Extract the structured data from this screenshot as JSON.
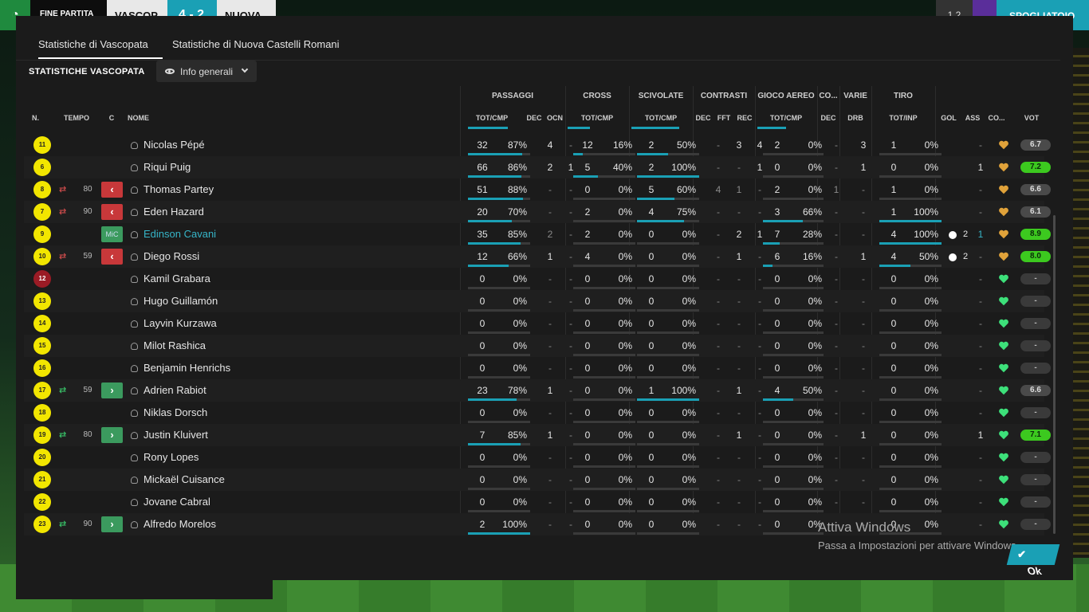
{
  "topbar": {
    "status": "FINE PARTITA",
    "home": "VASCOP",
    "score": "4 - 2",
    "away": "NUOVA",
    "counter": "1 2",
    "menu": "⌄",
    "next": "SPOGLIATOIO"
  },
  "tabs": [
    "Statistiche di Vascopata",
    "Statistiche di Nuova Castelli Romani"
  ],
  "section_title": "STATISTICHE VASCOPATA",
  "view_dropdown": "Info generali",
  "group_headers": {
    "passaggi": "PASSAGGI",
    "cross": "CROSS",
    "scivolate": "SCIVOLATE",
    "contrasti": "CONTRASTI",
    "gioco_aereo": "GIOCO AEREO",
    "co": "CO...",
    "varie": "VARIE",
    "tiro": "TIRO"
  },
  "col_headers": {
    "n": "N.",
    "tempo": "TEMPO",
    "c": "C",
    "nome": "NOME",
    "pass": "TOT/CMP",
    "pass_dec": "DEC",
    "pass_ocn": "OCN",
    "cross": "TOT/CMP",
    "sciv": "TOT/CMP",
    "con_dec": "DEC",
    "con_fft": "FFT",
    "con_rec": "REC",
    "aereo": "TOT/CMP",
    "co_dec": "DEC",
    "drb": "DRB",
    "tiro": "TOT/INP",
    "gol": "GOL",
    "ass": "ASS",
    "co2": "CO...",
    "vot": "VOT"
  },
  "players": [
    {
      "n": "11",
      "sub": "",
      "min": "",
      "pos": "",
      "name": "Nicolas Pépé",
      "hl": false,
      "pt": "32",
      "pp": "87%",
      "pf": 0.87,
      "pdec": "4",
      "pocn": "-",
      "ct": "12",
      "cp": "16%",
      "cf": 0.16,
      "st": "2",
      "sp": "50%",
      "sf": 0.5,
      "kdec": "-",
      "kfft": "3",
      "krec": "4",
      "at": "2",
      "ap": "0%",
      "af": 0,
      "codec": "-",
      "drb": "3",
      "tt": "1",
      "tp": "0%",
      "tf": 0,
      "gol": "",
      "ass": "-",
      "vot": "6.7",
      "vc": "grey"
    },
    {
      "n": "6",
      "sub": "",
      "min": "",
      "pos": "",
      "name": "Riqui Puig",
      "hl": false,
      "pt": "66",
      "pp": "86%",
      "pf": 0.86,
      "pdec": "2",
      "pocn": "1",
      "ct": "5",
      "cp": "40%",
      "cf": 0.4,
      "st": "2",
      "sp": "100%",
      "sf": 1,
      "kdec": "-",
      "kfft": "-",
      "krec": "1",
      "at": "0",
      "ap": "0%",
      "af": 0,
      "codec": "-",
      "drb": "1",
      "tt": "0",
      "tp": "0%",
      "tf": 0,
      "gol": "",
      "ass": "1",
      "vot": "7.2",
      "vc": "green"
    },
    {
      "n": "8",
      "sub": "out",
      "min": "80",
      "pos": "out",
      "name": "Thomas Partey",
      "hl": false,
      "pt": "51",
      "pp": "88%",
      "pf": 0.88,
      "pdec": "-",
      "pocn": "-",
      "ct": "0",
      "cp": "0%",
      "cf": 0,
      "st": "5",
      "sp": "60%",
      "sf": 0.6,
      "kdec": "4",
      "kfft": "1",
      "krec": "-",
      "at": "2",
      "ap": "0%",
      "af": 0,
      "codec": "1",
      "drb": "-",
      "tt": "1",
      "tp": "0%",
      "tf": 0,
      "gol": "",
      "ass": "-",
      "vot": "6.6",
      "vc": "grey"
    },
    {
      "n": "7",
      "sub": "out",
      "min": "90",
      "pos": "out",
      "name": "Eden Hazard",
      "hl": false,
      "pt": "20",
      "pp": "70%",
      "pf": 0.7,
      "pdec": "-",
      "pocn": "-",
      "ct": "2",
      "cp": "0%",
      "cf": 0,
      "st": "4",
      "sp": "75%",
      "sf": 0.75,
      "kdec": "-",
      "kfft": "-",
      "krec": "-",
      "at": "3",
      "ap": "66%",
      "af": 0.66,
      "codec": "-",
      "drb": "-",
      "tt": "1",
      "tp": "100%",
      "tf": 1,
      "gol": "",
      "ass": "-",
      "vot": "6.1",
      "vc": "grey"
    },
    {
      "n": "9",
      "sub": "",
      "min": "",
      "pos": "mc",
      "name": "Edinson Cavani",
      "hl": true,
      "pt": "35",
      "pp": "85%",
      "pf": 0.85,
      "pdec": "2",
      "pocn": "-",
      "ct": "2",
      "cp": "0%",
      "cf": 0,
      "st": "0",
      "sp": "0%",
      "sf": 0,
      "kdec": "-",
      "kfft": "2",
      "krec": "1",
      "at": "7",
      "ap": "28%",
      "af": 0.28,
      "codec": "-",
      "drb": "-",
      "tt": "4",
      "tp": "100%",
      "tf": 1,
      "gol": "2",
      "ass": "1",
      "vot": "8.9",
      "vc": "green"
    },
    {
      "n": "10",
      "sub": "out",
      "min": "59",
      "pos": "out",
      "name": "Diego Rossi",
      "hl": false,
      "pt": "12",
      "pp": "66%",
      "pf": 0.66,
      "pdec": "1",
      "pocn": "-",
      "ct": "4",
      "cp": "0%",
      "cf": 0,
      "st": "0",
      "sp": "0%",
      "sf": 0,
      "kdec": "-",
      "kfft": "1",
      "krec": "-",
      "at": "6",
      "ap": "16%",
      "af": 0.16,
      "codec": "-",
      "drb": "1",
      "tt": "4",
      "tp": "50%",
      "tf": 0.5,
      "gol": "2",
      "ass": "-",
      "vot": "8.0",
      "vc": "green"
    },
    {
      "n": "12",
      "sub": "",
      "min": "",
      "pos": "",
      "gk": true,
      "name": "Kamil Grabara",
      "hl": false,
      "pt": "0",
      "pp": "0%",
      "pf": 0,
      "pdec": "-",
      "pocn": "-",
      "ct": "0",
      "cp": "0%",
      "cf": 0,
      "st": "0",
      "sp": "0%",
      "sf": 0,
      "kdec": "-",
      "kfft": "-",
      "krec": "-",
      "at": "0",
      "ap": "0%",
      "af": 0,
      "codec": "-",
      "drb": "-",
      "tt": "0",
      "tp": "0%",
      "tf": 0,
      "gol": "",
      "ass": "-",
      "vot": "-",
      "vc": "none"
    },
    {
      "n": "13",
      "sub": "",
      "min": "",
      "pos": "",
      "name": "Hugo Guillamón",
      "hl": false,
      "pt": "0",
      "pp": "0%",
      "pf": 0,
      "pdec": "-",
      "pocn": "-",
      "ct": "0",
      "cp": "0%",
      "cf": 0,
      "st": "0",
      "sp": "0%",
      "sf": 0,
      "kdec": "-",
      "kfft": "-",
      "krec": "-",
      "at": "0",
      "ap": "0%",
      "af": 0,
      "codec": "-",
      "drb": "-",
      "tt": "0",
      "tp": "0%",
      "tf": 0,
      "gol": "",
      "ass": "-",
      "vot": "-",
      "vc": "none"
    },
    {
      "n": "14",
      "sub": "",
      "min": "",
      "pos": "",
      "name": "Layvin Kurzawa",
      "hl": false,
      "pt": "0",
      "pp": "0%",
      "pf": 0,
      "pdec": "-",
      "pocn": "-",
      "ct": "0",
      "cp": "0%",
      "cf": 0,
      "st": "0",
      "sp": "0%",
      "sf": 0,
      "kdec": "-",
      "kfft": "-",
      "krec": "-",
      "at": "0",
      "ap": "0%",
      "af": 0,
      "codec": "-",
      "drb": "-",
      "tt": "0",
      "tp": "0%",
      "tf": 0,
      "gol": "",
      "ass": "-",
      "vot": "-",
      "vc": "none"
    },
    {
      "n": "15",
      "sub": "",
      "min": "",
      "pos": "",
      "name": "Milot Rashica",
      "hl": false,
      "pt": "0",
      "pp": "0%",
      "pf": 0,
      "pdec": "-",
      "pocn": "-",
      "ct": "0",
      "cp": "0%",
      "cf": 0,
      "st": "0",
      "sp": "0%",
      "sf": 0,
      "kdec": "-",
      "kfft": "-",
      "krec": "-",
      "at": "0",
      "ap": "0%",
      "af": 0,
      "codec": "-",
      "drb": "-",
      "tt": "0",
      "tp": "0%",
      "tf": 0,
      "gol": "",
      "ass": "-",
      "vot": "-",
      "vc": "none"
    },
    {
      "n": "16",
      "sub": "",
      "min": "",
      "pos": "",
      "name": "Benjamin Henrichs",
      "hl": false,
      "pt": "0",
      "pp": "0%",
      "pf": 0,
      "pdec": "-",
      "pocn": "-",
      "ct": "0",
      "cp": "0%",
      "cf": 0,
      "st": "0",
      "sp": "0%",
      "sf": 0,
      "kdec": "-",
      "kfft": "-",
      "krec": "-",
      "at": "0",
      "ap": "0%",
      "af": 0,
      "codec": "-",
      "drb": "-",
      "tt": "0",
      "tp": "0%",
      "tf": 0,
      "gol": "",
      "ass": "-",
      "vot": "-",
      "vc": "none"
    },
    {
      "n": "17",
      "sub": "in",
      "min": "59",
      "pos": "in",
      "name": "Adrien Rabiot",
      "hl": false,
      "pt": "23",
      "pp": "78%",
      "pf": 0.78,
      "pdec": "1",
      "pocn": "-",
      "ct": "0",
      "cp": "0%",
      "cf": 0,
      "st": "1",
      "sp": "100%",
      "sf": 1,
      "kdec": "-",
      "kfft": "1",
      "krec": "-",
      "at": "4",
      "ap": "50%",
      "af": 0.5,
      "codec": "-",
      "drb": "-",
      "tt": "0",
      "tp": "0%",
      "tf": 0,
      "gol": "",
      "ass": "-",
      "vot": "6.6",
      "vc": "grey"
    },
    {
      "n": "18",
      "sub": "",
      "min": "",
      "pos": "",
      "name": "Niklas Dorsch",
      "hl": false,
      "pt": "0",
      "pp": "0%",
      "pf": 0,
      "pdec": "-",
      "pocn": "-",
      "ct": "0",
      "cp": "0%",
      "cf": 0,
      "st": "0",
      "sp": "0%",
      "sf": 0,
      "kdec": "-",
      "kfft": "-",
      "krec": "-",
      "at": "0",
      "ap": "0%",
      "af": 0,
      "codec": "-",
      "drb": "-",
      "tt": "0",
      "tp": "0%",
      "tf": 0,
      "gol": "",
      "ass": "-",
      "vot": "-",
      "vc": "none"
    },
    {
      "n": "19",
      "sub": "in",
      "min": "80",
      "pos": "in",
      "name": "Justin Kluivert",
      "hl": false,
      "pt": "7",
      "pp": "85%",
      "pf": 0.85,
      "pdec": "1",
      "pocn": "-",
      "ct": "0",
      "cp": "0%",
      "cf": 0,
      "st": "0",
      "sp": "0%",
      "sf": 0,
      "kdec": "-",
      "kfft": "1",
      "krec": "-",
      "at": "0",
      "ap": "0%",
      "af": 0,
      "codec": "-",
      "drb": "1",
      "tt": "0",
      "tp": "0%",
      "tf": 0,
      "gol": "",
      "ass": "1",
      "vot": "7.1",
      "vc": "green"
    },
    {
      "n": "20",
      "sub": "",
      "min": "",
      "pos": "",
      "name": "Rony Lopes",
      "hl": false,
      "pt": "0",
      "pp": "0%",
      "pf": 0,
      "pdec": "-",
      "pocn": "-",
      "ct": "0",
      "cp": "0%",
      "cf": 0,
      "st": "0",
      "sp": "0%",
      "sf": 0,
      "kdec": "-",
      "kfft": "-",
      "krec": "-",
      "at": "0",
      "ap": "0%",
      "af": 0,
      "codec": "-",
      "drb": "-",
      "tt": "0",
      "tp": "0%",
      "tf": 0,
      "gol": "",
      "ass": "-",
      "vot": "-",
      "vc": "none"
    },
    {
      "n": "21",
      "sub": "",
      "min": "",
      "pos": "",
      "name": "Mickaël Cuisance",
      "hl": false,
      "pt": "0",
      "pp": "0%",
      "pf": 0,
      "pdec": "-",
      "pocn": "-",
      "ct": "0",
      "cp": "0%",
      "cf": 0,
      "st": "0",
      "sp": "0%",
      "sf": 0,
      "kdec": "-",
      "kfft": "-",
      "krec": "-",
      "at": "0",
      "ap": "0%",
      "af": 0,
      "codec": "-",
      "drb": "-",
      "tt": "0",
      "tp": "0%",
      "tf": 0,
      "gol": "",
      "ass": "-",
      "vot": "-",
      "vc": "none"
    },
    {
      "n": "22",
      "sub": "",
      "min": "",
      "pos": "",
      "name": "Jovane Cabral",
      "hl": false,
      "pt": "0",
      "pp": "0%",
      "pf": 0,
      "pdec": "-",
      "pocn": "-",
      "ct": "0",
      "cp": "0%",
      "cf": 0,
      "st": "0",
      "sp": "0%",
      "sf": 0,
      "kdec": "-",
      "kfft": "-",
      "krec": "-",
      "at": "0",
      "ap": "0%",
      "af": 0,
      "codec": "-",
      "drb": "-",
      "tt": "0",
      "tp": "0%",
      "tf": 0,
      "gol": "",
      "ass": "-",
      "vot": "-",
      "vc": "none"
    },
    {
      "n": "23",
      "sub": "in",
      "min": "90",
      "pos": "in",
      "name": "Alfredo Morelos",
      "hl": false,
      "pt": "2",
      "pp": "100%",
      "pf": 1,
      "pdec": "-",
      "pocn": "-",
      "ct": "0",
      "cp": "0%",
      "cf": 0,
      "st": "0",
      "sp": "0%",
      "sf": 0,
      "kdec": "-",
      "kfft": "-",
      "krec": "-",
      "at": "0",
      "ap": "0%",
      "af": 0,
      "codec": "-",
      "drb": "-",
      "tt": "0",
      "tp": "0%",
      "tf": 0,
      "gol": "",
      "ass": "-",
      "vot": "-",
      "vc": "none"
    }
  ],
  "pos_mc_label": "MiC",
  "ok_button": "Ok",
  "watermark": {
    "line1": "Attiva Windows",
    "line2": "Passa a Impostazioni per attivare Windows."
  },
  "colors": {
    "accent": "#1aa0b5",
    "rating_green": "#3cc91f",
    "sub_out": "#c8383a",
    "sub_in": "#3b9a5e",
    "shirt": "#f2e600",
    "gk_shirt": "#9a1b25"
  }
}
